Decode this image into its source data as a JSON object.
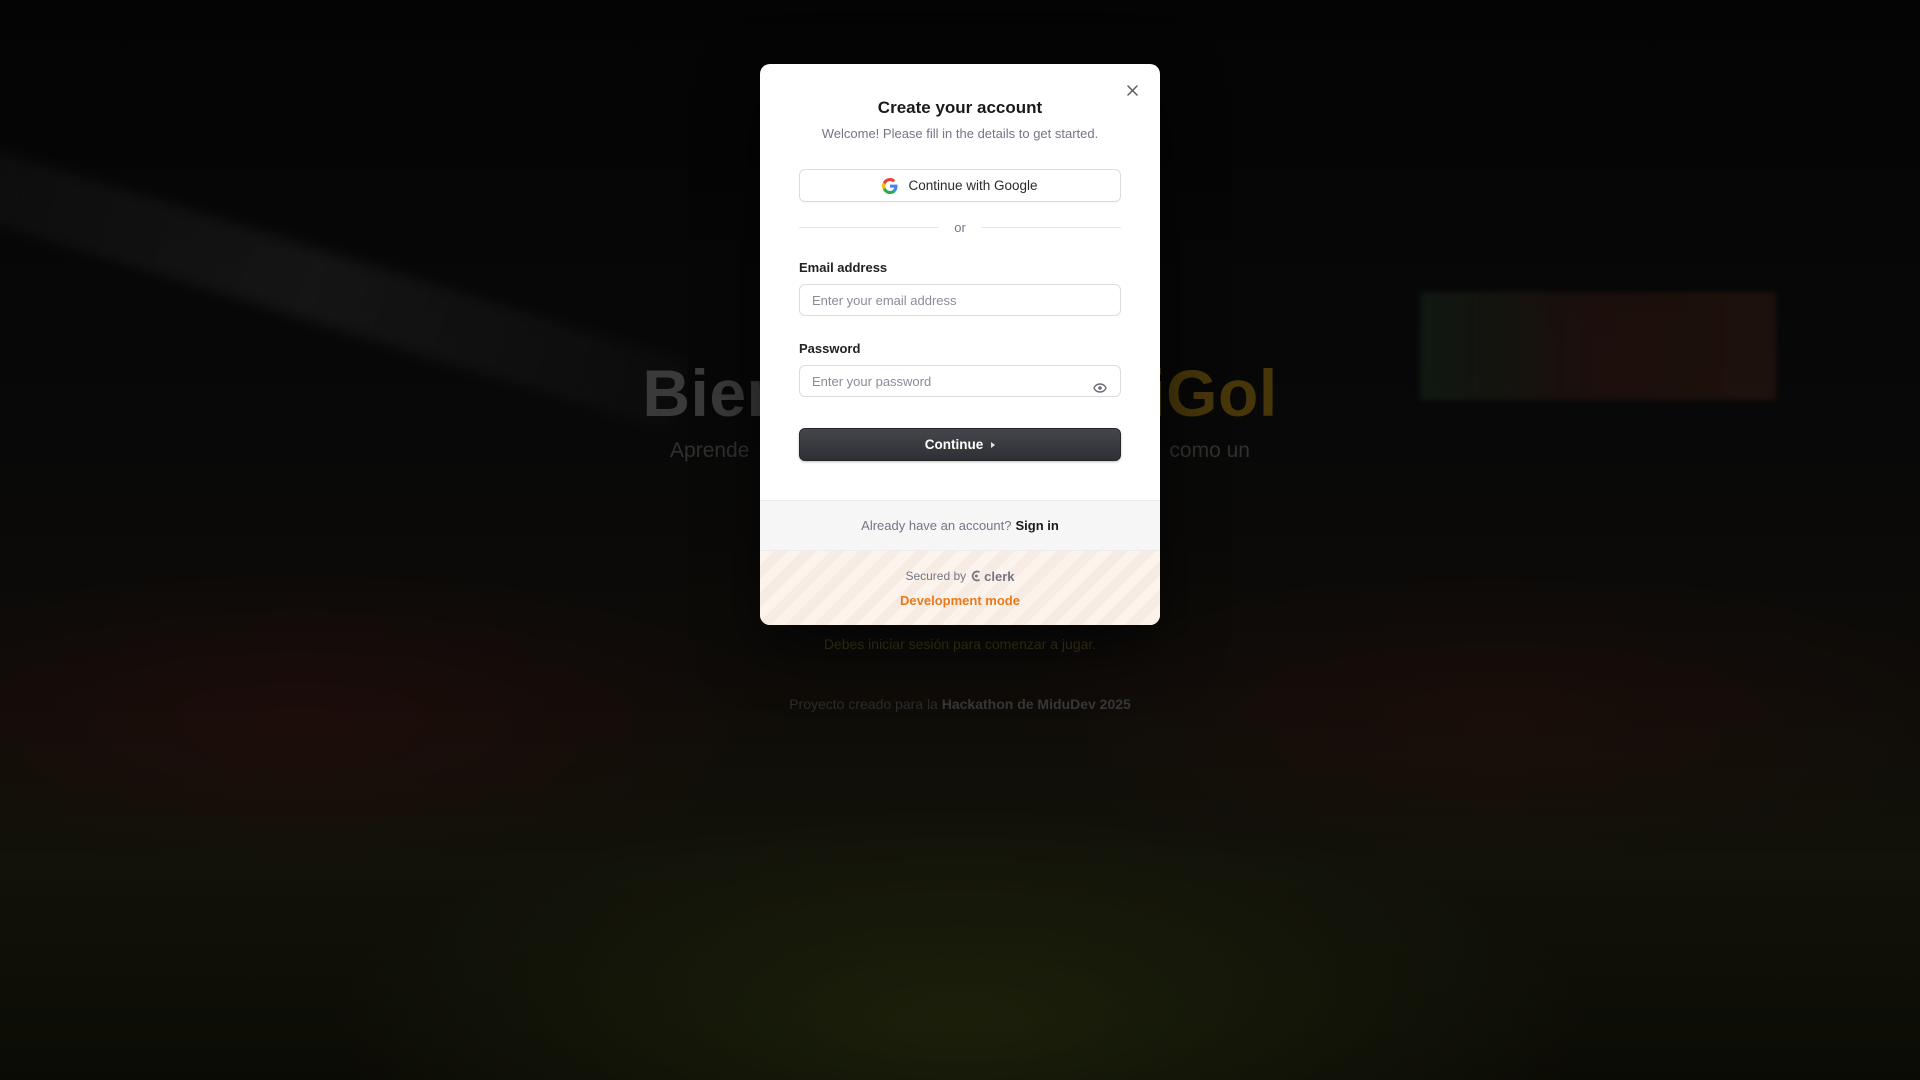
{
  "background": {
    "hero_title_left": "Bien",
    "hero_title_right": "iGol",
    "hero_subtitle_left": "Aprende",
    "hero_subtitle_right": "como un",
    "login_note": "Debes iniciar sesión para comenzar a jugar.",
    "credit_prefix": "Proyecto creado para la",
    "credit_event": "Hackathon de MiduDev 2025"
  },
  "modal": {
    "title": "Create your account",
    "subtitle": "Welcome! Please fill in the details to get started.",
    "google_button": "Continue with Google",
    "divider_text": "or",
    "email_label": "Email address",
    "email_placeholder": "Enter your email address",
    "email_value": "",
    "password_label": "Password",
    "password_placeholder": "Enter your password",
    "password_value": "",
    "continue_button": "Continue",
    "signin_prompt": "Already have an account?",
    "signin_link": "Sign in",
    "secured_by": "Secured by",
    "clerk_brand": "clerk",
    "dev_mode": "Development mode"
  },
  "icons": {
    "close": "close-icon",
    "google": "google-icon",
    "eye": "eye-icon",
    "continue_arrow": "caret-right-icon",
    "clerk": "clerk-logo-icon"
  },
  "colors": {
    "primary_button": "#2f3035",
    "dev_mode": "#e87a1e",
    "hero_accent": "#6e5410"
  }
}
